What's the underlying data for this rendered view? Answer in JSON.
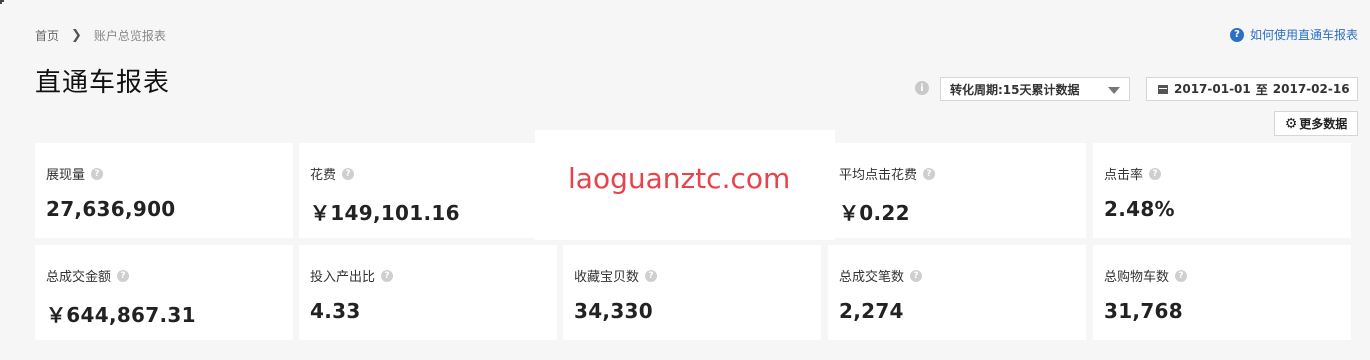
{
  "breadcrumb": {
    "home": "首页",
    "current": "账户总览报表"
  },
  "help": {
    "label": "如何使用直通车报表"
  },
  "page_title": "直通车报表",
  "period_select": {
    "value": "转化周期:15天累计数据"
  },
  "date_range": {
    "start": "2017-01-01",
    "sep": "至",
    "end": "2017-02-16"
  },
  "more_button": {
    "label": "更多数据"
  },
  "watermark": "laoguanztc.com",
  "metrics": [
    {
      "label": "展现量",
      "value": "27,636,900"
    },
    {
      "label": "花费",
      "value": "￥149,101.16"
    },
    {
      "label": "",
      "value": ""
    },
    {
      "label": "平均点击花费",
      "value": "￥0.22"
    },
    {
      "label": "点击率",
      "value": "2.48%"
    },
    {
      "label": "总成交金额",
      "value": "￥644,867.31"
    },
    {
      "label": "投入产出比",
      "value": "4.33"
    },
    {
      "label": "收藏宝贝数",
      "value": "34,330"
    },
    {
      "label": "总成交笔数",
      "value": "2,274"
    },
    {
      "label": "总购物车数",
      "value": "31,768"
    }
  ]
}
